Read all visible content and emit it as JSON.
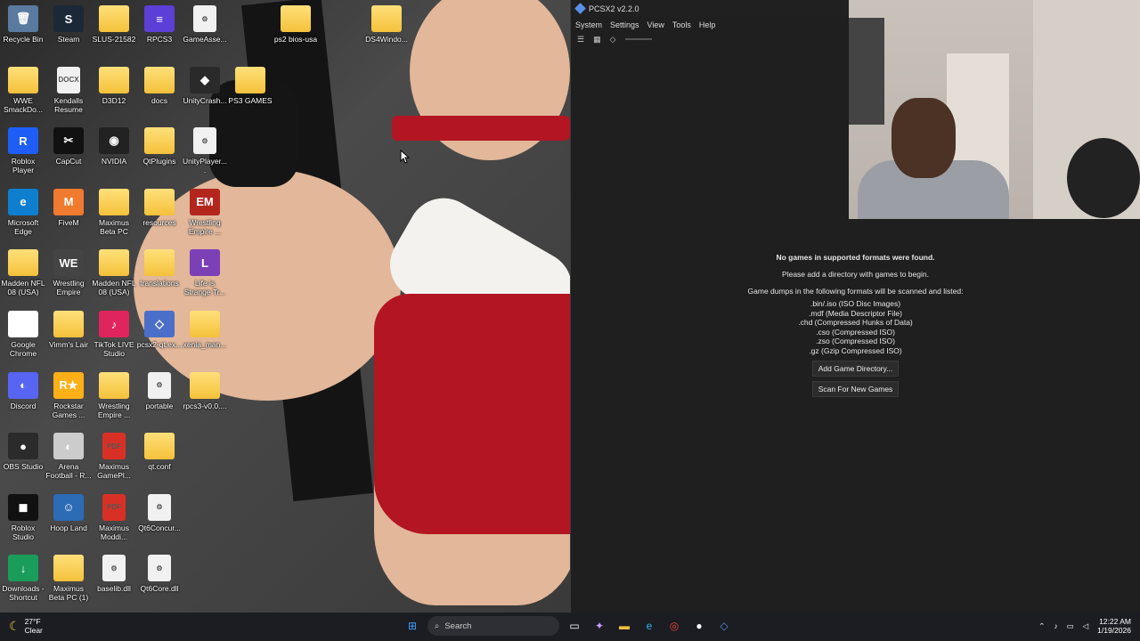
{
  "desktop": {
    "icons": [
      {
        "label": "Recycle Bin",
        "glyph": "🗑"
      },
      {
        "label": "Steam",
        "glyph": "S"
      },
      {
        "label": "SLUS-21582",
        "glyph": ""
      },
      {
        "label": "RPCS3",
        "glyph": "≡"
      },
      {
        "label": "GameAsse...",
        "glyph": "⚙"
      },
      {
        "label": "ps2 bios-usa",
        "glyph": ""
      },
      {
        "label": "DS4Windo...",
        "glyph": ""
      },
      {
        "label": "WWE SmackDo...",
        "glyph": ""
      },
      {
        "label": "Kendalls Resume",
        "glyph": "DOCX"
      },
      {
        "label": "D3D12",
        "glyph": ""
      },
      {
        "label": "docs",
        "glyph": ""
      },
      {
        "label": "UnityCrash...",
        "glyph": "◆"
      },
      {
        "label": "PS3 GAMES",
        "glyph": ""
      },
      {
        "label": "Roblox Player",
        "glyph": "R"
      },
      {
        "label": "CapCut",
        "glyph": "✂"
      },
      {
        "label": "NVIDIA",
        "glyph": "◉"
      },
      {
        "label": "QtPlugins",
        "glyph": ""
      },
      {
        "label": "UnityPlayer....",
        "glyph": "⚙"
      },
      {
        "label": "Microsoft Edge",
        "glyph": "e"
      },
      {
        "label": "FiveM",
        "glyph": "M"
      },
      {
        "label": "Maximus Beta PC",
        "glyph": ""
      },
      {
        "label": "resources",
        "glyph": ""
      },
      {
        "label": "Wrestling Empire ...",
        "glyph": "EM"
      },
      {
        "label": "Madden NFL 08 (USA)",
        "glyph": ""
      },
      {
        "label": "Wrestling Empire",
        "glyph": "WE"
      },
      {
        "label": "Madden NFL 08 (USA)",
        "glyph": ""
      },
      {
        "label": "translations",
        "glyph": ""
      },
      {
        "label": "Life is Strange Tr...",
        "glyph": "L"
      },
      {
        "label": "Google Chrome",
        "glyph": "◎"
      },
      {
        "label": "Vimm's Lair",
        "glyph": ""
      },
      {
        "label": "TikTok LIVE Studio",
        "glyph": "♪"
      },
      {
        "label": "pcsx2-qt.ex...",
        "glyph": "◇"
      },
      {
        "label": "xenia_man...",
        "glyph": ""
      },
      {
        "label": "Discord",
        "glyph": "◐"
      },
      {
        "label": "Rockstar Games ...",
        "glyph": "R★"
      },
      {
        "label": "Wrestling Empire ...",
        "glyph": ""
      },
      {
        "label": "portable",
        "glyph": "⚙"
      },
      {
        "label": "rpcs3-v0.0....",
        "glyph": ""
      },
      {
        "label": "OBS Studio",
        "glyph": "●"
      },
      {
        "label": "Arena Football - R...",
        "glyph": "◐"
      },
      {
        "label": "Maximus GamePl...",
        "glyph": "PDF"
      },
      {
        "label": "qt.conf",
        "glyph": ""
      },
      {
        "label": "Roblox Studio",
        "glyph": "◼"
      },
      {
        "label": "Hoop Land",
        "glyph": "☺"
      },
      {
        "label": "Maximus Moddi...",
        "glyph": "PDF"
      },
      {
        "label": "Qt6Concur...",
        "glyph": "⚙"
      },
      {
        "label": "Downloads - Shortcut",
        "glyph": "↓"
      },
      {
        "label": "Maximus Beta PC (1)",
        "glyph": ""
      },
      {
        "label": "baselib.dll",
        "glyph": "⚙"
      },
      {
        "label": "Qt6Core.dll",
        "glyph": "⚙"
      }
    ]
  },
  "pcsx2": {
    "title": "PCSX2 v2.2.0",
    "menu": [
      "System",
      "Settings",
      "View",
      "Tools",
      "Help"
    ],
    "empty_title": "No games in supported formats were found.",
    "empty_hint": "Please add a directory with games to begin.",
    "formats_intro": "Game dumps in the following formats will be scanned and listed:",
    "formats": [
      ".bin/.iso (ISO Disc Images)",
      ".mdf (Media Descriptor File)",
      ".chd (Compressed Hunks of Data)",
      ".cso (Compressed ISO)",
      ".zso (Compressed ISO)",
      ".gz (Gzip Compressed ISO)"
    ],
    "add_dir_button": "Add Game Directory...",
    "scan_button": "Scan For New Games"
  },
  "taskbar": {
    "temperature": "27°F",
    "weather": "Clear",
    "search_label": "Search",
    "time": "12:22 AM",
    "date": "1/19/2026"
  }
}
